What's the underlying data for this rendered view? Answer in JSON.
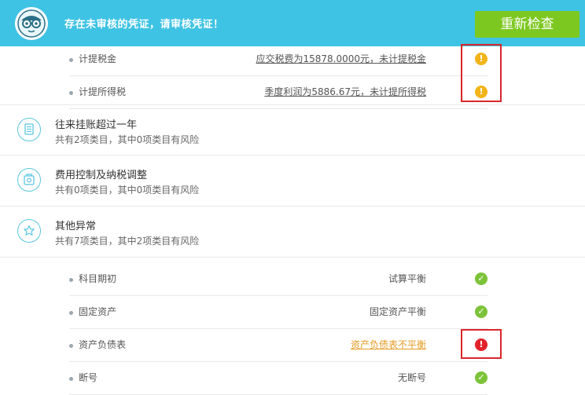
{
  "header": {
    "message": "存在未审核的凭证，请审核凭证！",
    "recheck_label": "重新检查",
    "accent_color": "#3fc3e4",
    "button_color": "#7dc820"
  },
  "top_items": [
    {
      "label": "计提税金",
      "value": "应交税费为15878.0000元，未计提税金",
      "status": "info"
    },
    {
      "label": "计提所得税",
      "value": "季度利润为5886.67元，未计提所得税",
      "status": "info"
    }
  ],
  "sections": [
    {
      "title": "往来挂账超过一年",
      "summary": "共有2项类目，其中0项类目有风险",
      "icon": "document-icon"
    },
    {
      "title": "费用控制及纳税调整",
      "summary": "共有0项类目，其中0项类目有风险",
      "icon": "tax-icon"
    },
    {
      "title": "其他异常",
      "summary": "共有7项类目，其中2项类目有风险",
      "icon": "star-icon"
    }
  ],
  "other_items": [
    {
      "label": "科目期初",
      "value": "试算平衡",
      "status": "ok"
    },
    {
      "label": "固定资产",
      "value": "固定资产平衡",
      "status": "ok"
    },
    {
      "label": "资产负债表",
      "value": "资产负债表不平衡",
      "status": "error"
    },
    {
      "label": "断号",
      "value": "无断号",
      "status": "ok"
    }
  ],
  "status_colors": {
    "info": "#f2b418",
    "ok": "#7dc33a",
    "error": "#e3232a"
  }
}
